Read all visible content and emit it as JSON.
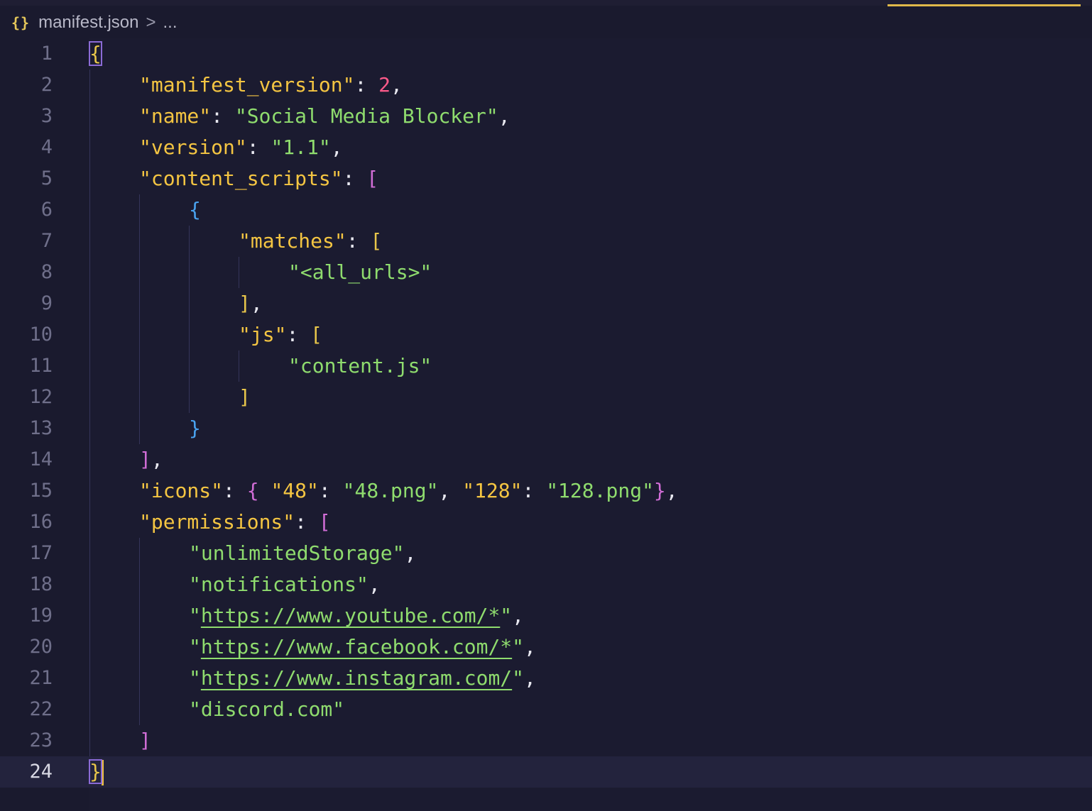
{
  "breadcrumb": {
    "file_icon": "json-file-icon",
    "file_icon_glyph": "{}",
    "file_name": "manifest.json",
    "separator": ">",
    "more": "..."
  },
  "colors": {
    "background": "#1a1a2e",
    "key": "#f4c542",
    "string": "#8fdc6e",
    "number": "#ff5a8a",
    "bracket_level1": "#e8c64a",
    "bracket_level2": "#d16dd6",
    "bracket_level3": "#4aa3f0",
    "accent": "#e0b94a"
  },
  "editor": {
    "current_line": 24,
    "lines": [
      {
        "n": "1",
        "indent": 0,
        "tokens": [
          [
            "b1",
            "{"
          ]
        ]
      },
      {
        "n": "2",
        "indent": 1,
        "tokens": [
          [
            "key",
            "\"manifest_version\""
          ],
          [
            "punc",
            ": "
          ],
          [
            "num",
            "2"
          ],
          [
            "punc",
            ","
          ]
        ]
      },
      {
        "n": "3",
        "indent": 1,
        "tokens": [
          [
            "key",
            "\"name\""
          ],
          [
            "punc",
            ": "
          ],
          [
            "str",
            "\"Social Media Blocker\""
          ],
          [
            "punc",
            ","
          ]
        ]
      },
      {
        "n": "4",
        "indent": 1,
        "tokens": [
          [
            "key",
            "\"version\""
          ],
          [
            "punc",
            ": "
          ],
          [
            "str",
            "\"1.1\""
          ],
          [
            "punc",
            ","
          ]
        ]
      },
      {
        "n": "5",
        "indent": 1,
        "tokens": [
          [
            "key",
            "\"content_scripts\""
          ],
          [
            "punc",
            ": "
          ],
          [
            "b2",
            "["
          ]
        ]
      },
      {
        "n": "6",
        "indent": 2,
        "tokens": [
          [
            "b3",
            "{"
          ]
        ]
      },
      {
        "n": "7",
        "indent": 3,
        "tokens": [
          [
            "key",
            "\"matches\""
          ],
          [
            "punc",
            ": "
          ],
          [
            "b1",
            "["
          ]
        ]
      },
      {
        "n": "8",
        "indent": 4,
        "tokens": [
          [
            "str",
            "\"<all_urls>\""
          ]
        ]
      },
      {
        "n": "9",
        "indent": 3,
        "tokens": [
          [
            "b1",
            "]"
          ],
          [
            "punc",
            ","
          ]
        ]
      },
      {
        "n": "10",
        "indent": 3,
        "tokens": [
          [
            "key",
            "\"js\""
          ],
          [
            "punc",
            ": "
          ],
          [
            "b1",
            "["
          ]
        ]
      },
      {
        "n": "11",
        "indent": 4,
        "tokens": [
          [
            "str",
            "\"content.js\""
          ]
        ]
      },
      {
        "n": "12",
        "indent": 3,
        "tokens": [
          [
            "b1",
            "]"
          ]
        ]
      },
      {
        "n": "13",
        "indent": 2,
        "tokens": [
          [
            "b3",
            "}"
          ]
        ]
      },
      {
        "n": "14",
        "indent": 1,
        "tokens": [
          [
            "b2",
            "]"
          ],
          [
            "punc",
            ","
          ]
        ]
      },
      {
        "n": "15",
        "indent": 1,
        "tokens": [
          [
            "key",
            "\"icons\""
          ],
          [
            "punc",
            ": "
          ],
          [
            "b2",
            "{"
          ],
          [
            "punc",
            " "
          ],
          [
            "key",
            "\"48\""
          ],
          [
            "punc",
            ": "
          ],
          [
            "str",
            "\"48.png\""
          ],
          [
            "punc",
            ", "
          ],
          [
            "key",
            "\"128\""
          ],
          [
            "punc",
            ": "
          ],
          [
            "str",
            "\"128.png\""
          ],
          [
            "b2",
            "}"
          ],
          [
            "punc",
            ","
          ]
        ]
      },
      {
        "n": "16",
        "indent": 1,
        "tokens": [
          [
            "key",
            "\"permissions\""
          ],
          [
            "punc",
            ": "
          ],
          [
            "b2",
            "["
          ]
        ]
      },
      {
        "n": "17",
        "indent": 2,
        "tokens": [
          [
            "str",
            "\"unlimitedStorage\""
          ],
          [
            "punc",
            ","
          ]
        ]
      },
      {
        "n": "18",
        "indent": 2,
        "tokens": [
          [
            "str",
            "\"notifications\""
          ],
          [
            "punc",
            ","
          ]
        ]
      },
      {
        "n": "19",
        "indent": 2,
        "tokens": [
          [
            "str",
            "\""
          ],
          [
            "link",
            "https://www.youtube.com/*"
          ],
          [
            "str",
            "\""
          ],
          [
            "punc",
            ","
          ]
        ]
      },
      {
        "n": "20",
        "indent": 2,
        "tokens": [
          [
            "str",
            "\""
          ],
          [
            "link",
            "https://www.facebook.com/*"
          ],
          [
            "str",
            "\""
          ],
          [
            "punc",
            ","
          ]
        ]
      },
      {
        "n": "21",
        "indent": 2,
        "tokens": [
          [
            "str",
            "\""
          ],
          [
            "link",
            "https://www.instagram.com/"
          ],
          [
            "str",
            "\""
          ],
          [
            "punc",
            ","
          ]
        ]
      },
      {
        "n": "22",
        "indent": 2,
        "tokens": [
          [
            "str",
            "\"discord.com\""
          ]
        ]
      },
      {
        "n": "23",
        "indent": 1,
        "tokens": [
          [
            "b2",
            "]"
          ]
        ]
      },
      {
        "n": "24",
        "indent": 0,
        "tokens": [
          [
            "b1",
            "}"
          ]
        ]
      }
    ]
  }
}
